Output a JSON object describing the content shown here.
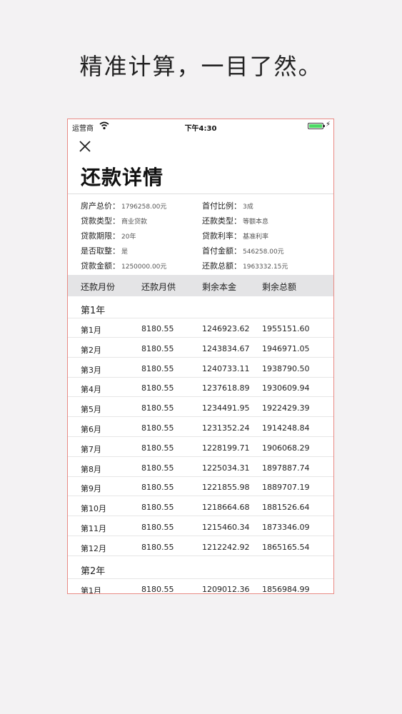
{
  "headline": "精准计算，一目了然。",
  "status_bar": {
    "carrier": "运营商",
    "time": "下午4:30"
  },
  "title": "还款详情",
  "info": [
    {
      "label": "房产总价：",
      "value": "1796258.00元"
    },
    {
      "label": "首付比例：",
      "value": "3成"
    },
    {
      "label": "贷款类型：",
      "value": "商业贷款"
    },
    {
      "label": "还款类型：",
      "value": "等额本息"
    },
    {
      "label": "贷款期限：",
      "value": "20年"
    },
    {
      "label": "贷款利率：",
      "value": "基准利率"
    },
    {
      "label": "是否取整：",
      "value": "是"
    },
    {
      "label": "首付金额：",
      "value": "546258.00元"
    },
    {
      "label": "贷款金额：",
      "value": "1250000.00元"
    },
    {
      "label": "还款总额：",
      "value": "1963332.15元"
    }
  ],
  "table": {
    "headers": [
      "还款月份",
      "还款月供",
      "剩余本金",
      "剩余总额"
    ],
    "year1": "第1年",
    "year1_rows": [
      [
        "第1月",
        "8180.55",
        "1246923.62",
        "1955151.60"
      ],
      [
        "第2月",
        "8180.55",
        "1243834.67",
        "1946971.05"
      ],
      [
        "第3月",
        "8180.55",
        "1240733.11",
        "1938790.50"
      ],
      [
        "第4月",
        "8180.55",
        "1237618.89",
        "1930609.94"
      ],
      [
        "第5月",
        "8180.55",
        "1234491.95",
        "1922429.39"
      ],
      [
        "第6月",
        "8180.55",
        "1231352.24",
        "1914248.84"
      ],
      [
        "第7月",
        "8180.55",
        "1228199.71",
        "1906068.29"
      ],
      [
        "第8月",
        "8180.55",
        "1225034.31",
        "1897887.74"
      ],
      [
        "第9月",
        "8180.55",
        "1221855.98",
        "1889707.19"
      ],
      [
        "第10月",
        "8180.55",
        "1218664.68",
        "1881526.64"
      ],
      [
        "第11月",
        "8180.55",
        "1215460.34",
        "1873346.09"
      ],
      [
        "第12月",
        "8180.55",
        "1212242.92",
        "1865165.54"
      ]
    ],
    "year2": "第2年",
    "year2_rows": [
      [
        "第1月",
        "8180.55",
        "1209012.36",
        "1856984.99"
      ]
    ]
  }
}
